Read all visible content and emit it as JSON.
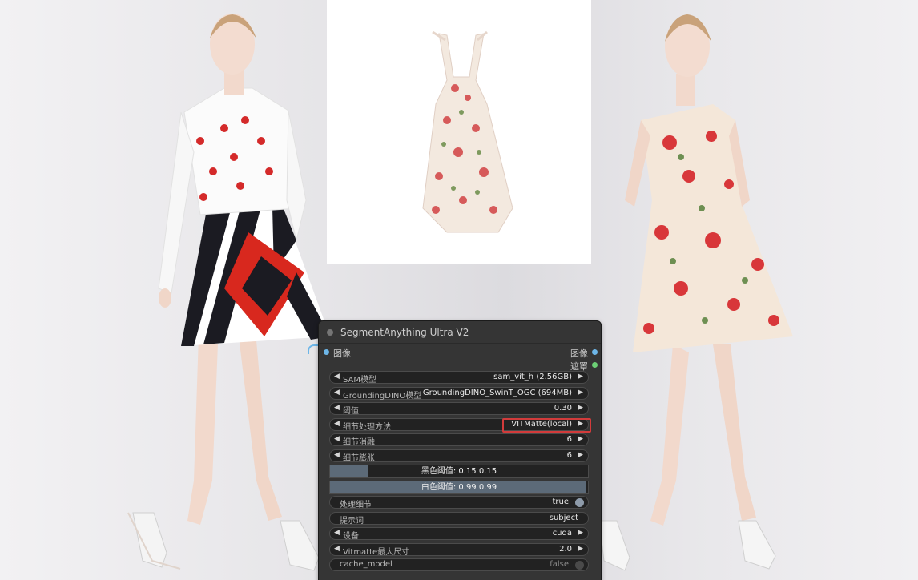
{
  "node": {
    "title": "SegmentAnything Ultra V2",
    "input_image_label": "图像",
    "output_image_label": "图像",
    "output_mask_label": "遮罩",
    "widgets": [
      {
        "label": "SAM模型",
        "value": "sam_vit_h (2.56GB)",
        "type": "combo"
      },
      {
        "label": "GroundingDINO模型",
        "value": "GroundingDINO_SwinT_OGC (694MB)",
        "type": "combo"
      },
      {
        "label": "阈值",
        "value": "0.30",
        "type": "number"
      },
      {
        "label": "细节处理方法",
        "value": "VITMatte(local)",
        "type": "combo"
      },
      {
        "label": "细节消融",
        "value": "6",
        "type": "number"
      },
      {
        "label": "细节膨胀",
        "value": "6",
        "type": "number"
      }
    ],
    "sliders": [
      {
        "label": "黑色阈值",
        "value_text": "黑色阈值: 0.15  0.15",
        "value": 0.15
      },
      {
        "label": "白色阈值",
        "value_text": "白色阈值: 0.99  0.99",
        "value": 0.99
      }
    ],
    "process_detail": {
      "label": "处理细节",
      "value": "true"
    },
    "prompt": {
      "label": "提示词",
      "value": "subject"
    },
    "device": {
      "label": "设备",
      "value": "cuda"
    },
    "vitmatte_max": {
      "label": "Vitmatte最大尺寸",
      "value": "2.0"
    },
    "cache_model": {
      "label": "cache_model",
      "value": "false"
    }
  },
  "colors": {
    "node_bg": "#353535",
    "widget_bg": "#222222",
    "input_dot": "#6db6e8",
    "mask_dot": "#6ccf75",
    "highlight": "#d23b3b"
  }
}
